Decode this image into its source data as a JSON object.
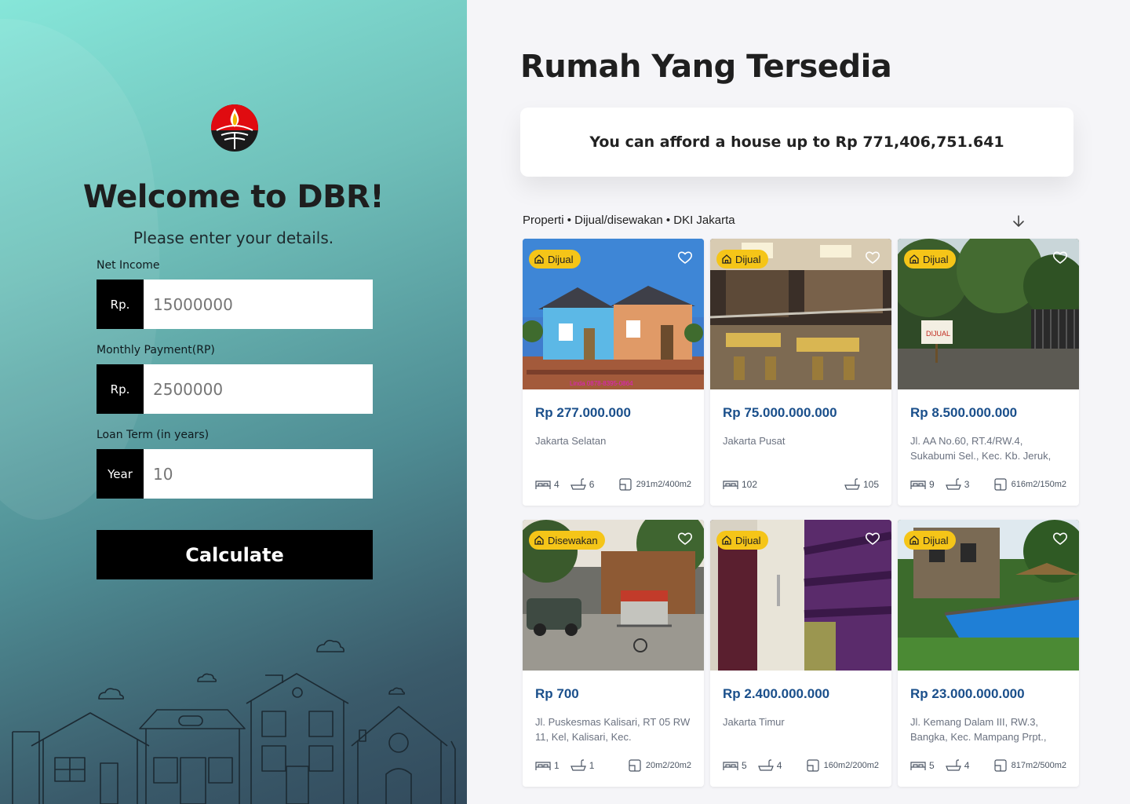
{
  "left": {
    "title": "Welcome to DBR!",
    "subtitle": "Please enter your details.",
    "fields": [
      {
        "label": "Net Income",
        "prefix": "Rp.",
        "value": "15000000"
      },
      {
        "label": "Monthly Payment(RP)",
        "prefix": "Rp.",
        "value": "2500000"
      },
      {
        "label": "Loan Term (in years)",
        "prefix": "Year",
        "value": "10"
      }
    ],
    "calculate_label": "Calculate"
  },
  "right": {
    "title": "Rumah Yang Tersedia",
    "afford_text": "You can afford a house up to Rp 771,406,751.641",
    "breadcrumb": "Properti • Dijual/disewakan • DKI Jakarta",
    "listings": [
      {
        "status": "Dijual",
        "price": "Rp 277.000.000",
        "address": "Jakarta Selatan",
        "beds": "4",
        "baths": "6",
        "area": "291m2/400m2",
        "photo_watermark": "Linda 0878-8395-0864"
      },
      {
        "status": "Dijual",
        "price": "Rp 75.000.000.000",
        "address": "Jakarta Pusat",
        "beds": "102",
        "baths": "105",
        "area": ""
      },
      {
        "status": "Dijual",
        "price": "Rp 8.500.000.000",
        "address": "Jl. AA No.60, RT.4/RW.4, Sukabumi Sel., Kec. Kb. Jeruk,",
        "beds": "9",
        "baths": "3",
        "area": "616m2/150m2"
      },
      {
        "status": "Disewakan",
        "price": "Rp 700",
        "address": "Jl. Puskesmas Kalisari, RT 05 RW 11, Kel, Kalisari, Kec.",
        "beds": "1",
        "baths": "1",
        "area": "20m2/20m2"
      },
      {
        "status": "Dijual",
        "price": "Rp 2.400.000.000",
        "address": "Jakarta Timur",
        "beds": "5",
        "baths": "4",
        "area": "160m2/200m2"
      },
      {
        "status": "Dijual",
        "price": "Rp 23.000.000.000",
        "address": "Jl. Kemang Dalam III, RW.3, Bangka, Kec. Mampang Prpt.,",
        "beds": "5",
        "baths": "4",
        "area": "817m2/500m2"
      }
    ]
  },
  "colors": {
    "badge": "#f5c518",
    "price": "#1a4f8b",
    "button": "#000000"
  },
  "icons": [
    "university-logo-icon",
    "sort-arrow-icon",
    "home-icon",
    "heart-icon",
    "bed-icon",
    "bath-icon",
    "area-icon"
  ]
}
